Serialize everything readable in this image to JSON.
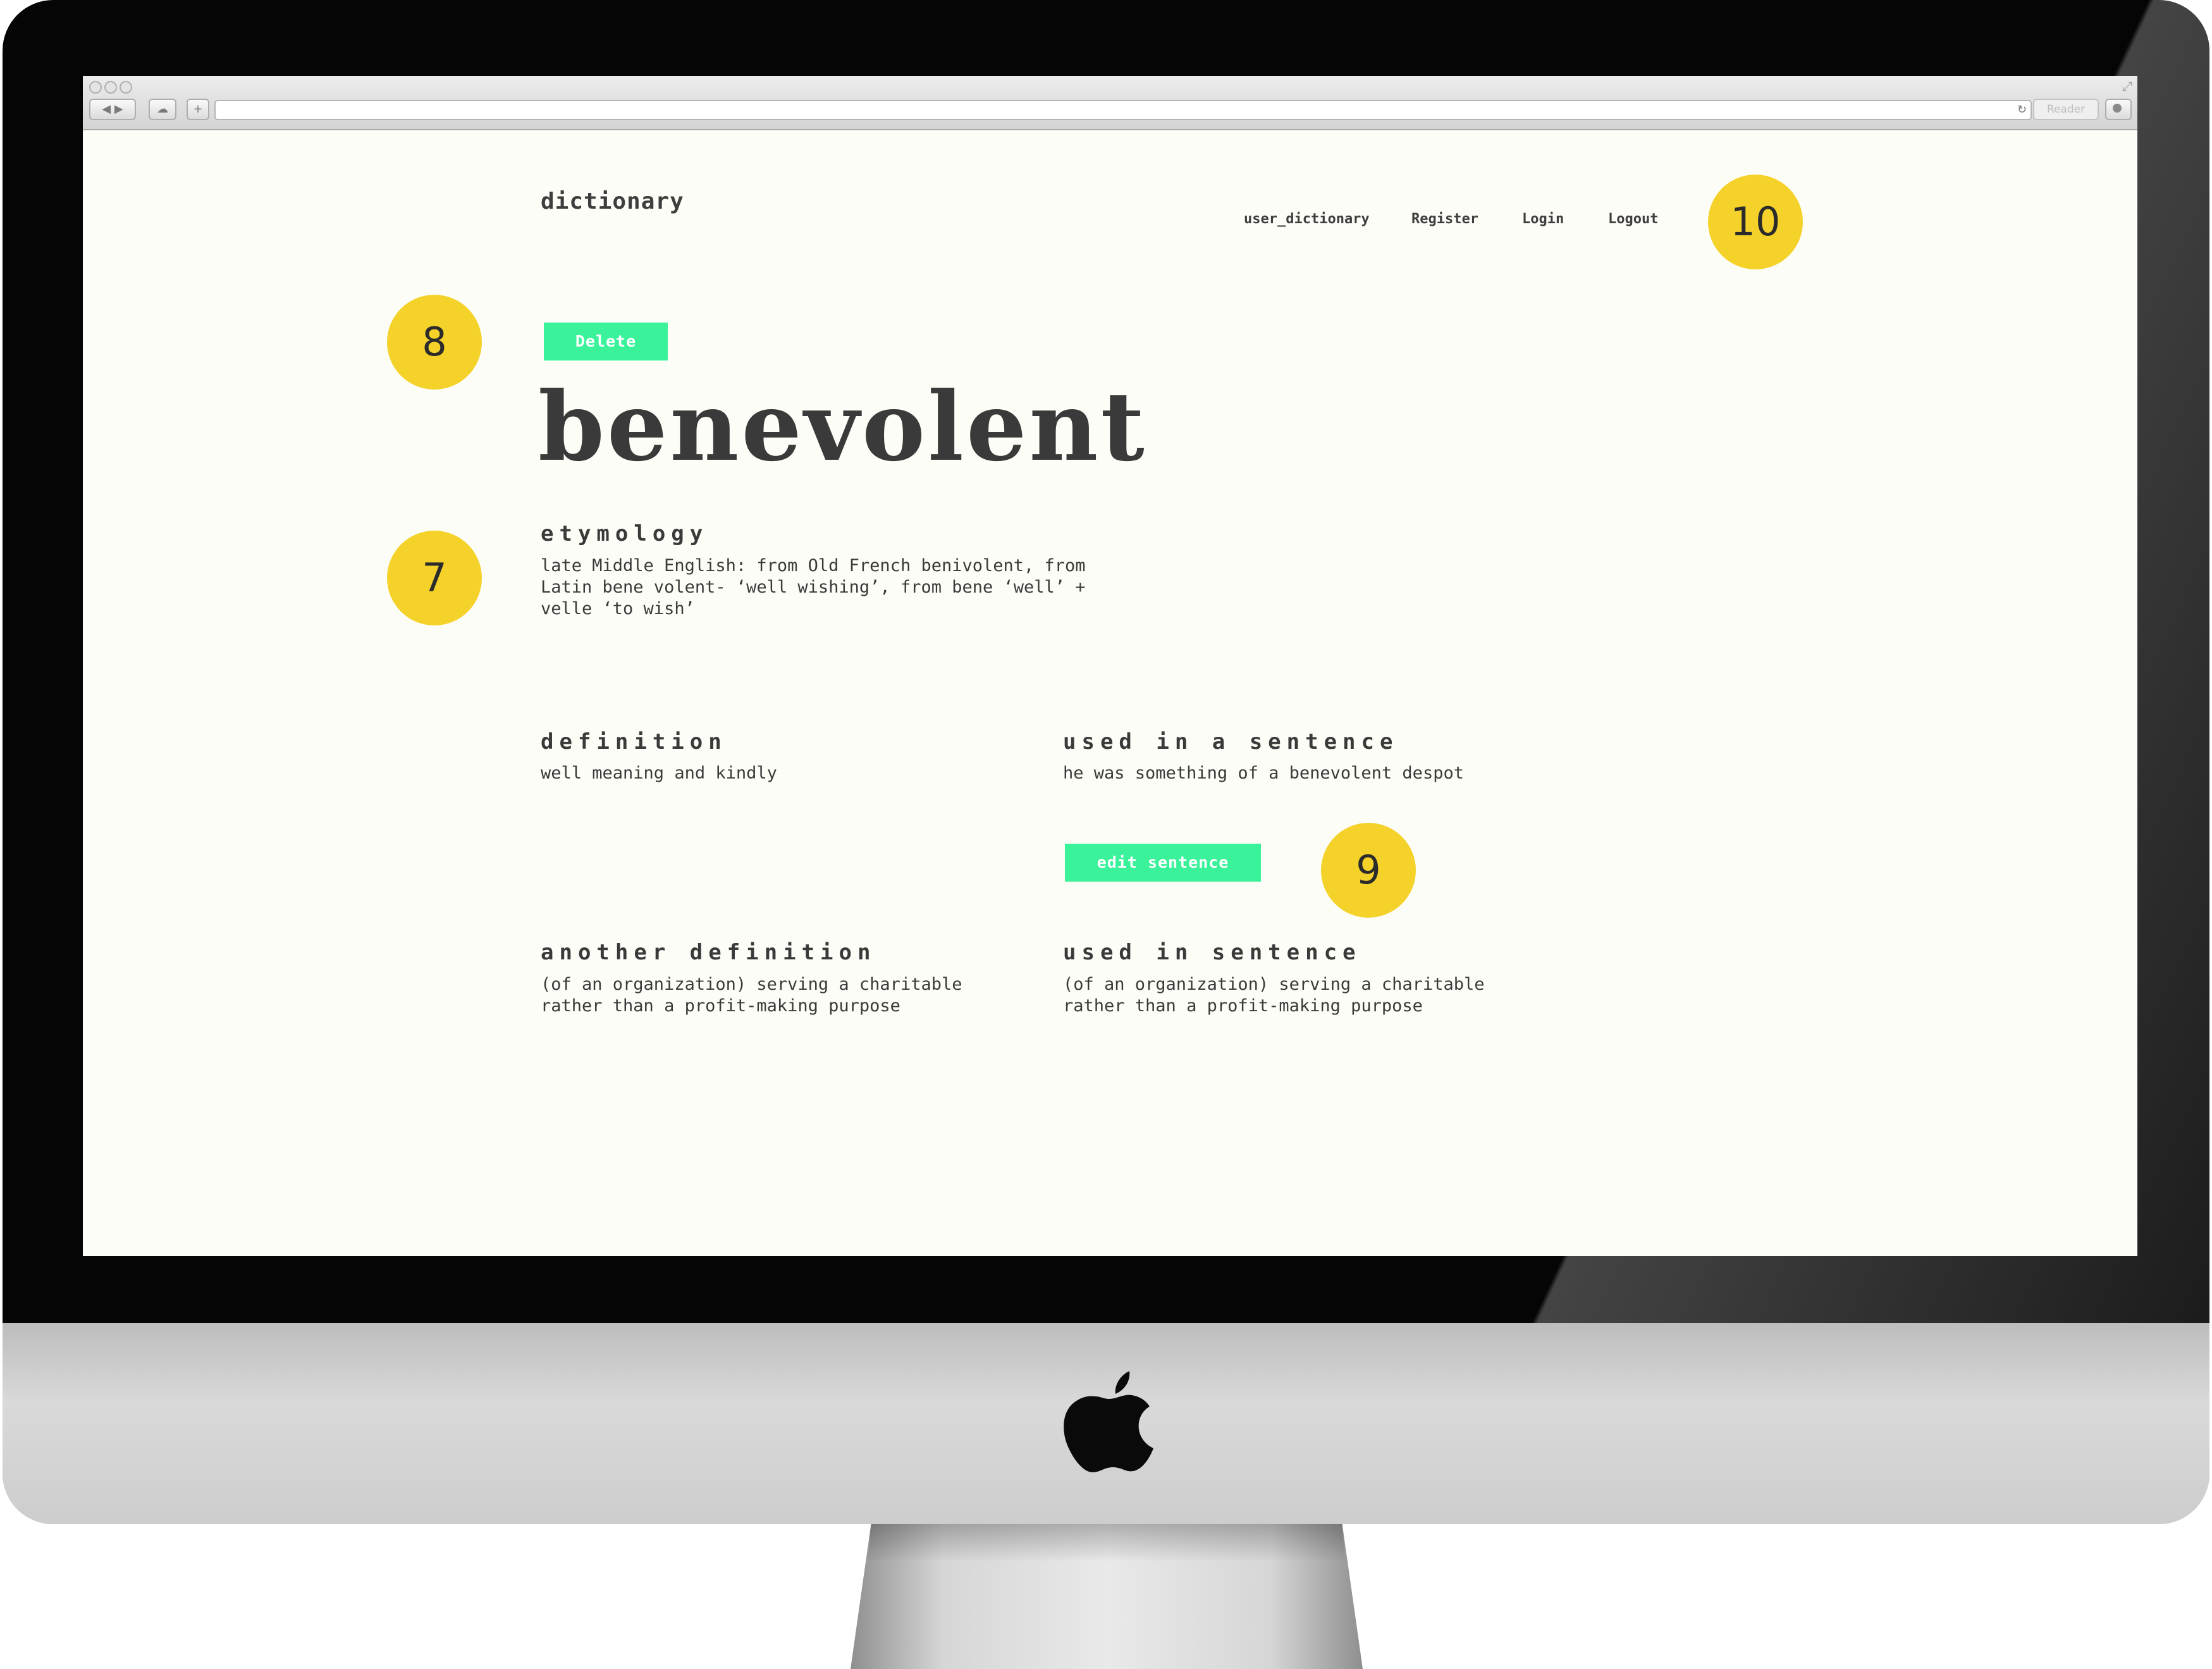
{
  "page": {
    "logo": "dictionary",
    "nav": [
      "user_dictionary",
      "Register",
      "Login",
      "Logout"
    ],
    "delete_label": "Delete",
    "word": "benevolent",
    "etymology": {
      "heading": "etymology",
      "text": "late Middle English: from Old French benivolent, from\nLatin bene volent- ‘well wishing’, from bene ‘well’ +\nvelle ‘to wish’"
    },
    "definition": {
      "heading": "definition",
      "text": "well meaning and kindly"
    },
    "sentence": {
      "heading": "used in a sentence",
      "text": "he was something of a benevolent despot"
    },
    "edit_sentence_label": "edit sentence",
    "another_definition": {
      "heading": "another definition",
      "text": "(of an organization) serving a charitable\nrather than a profit-making purpose"
    },
    "sentence2": {
      "heading": "used in sentence",
      "text": "(of an organization) serving a charitable\nrather than a profit-making purpose"
    }
  },
  "markers": [
    "10",
    "8",
    "7",
    "9"
  ],
  "browser": {
    "reader_label": "Reader"
  },
  "colors": {
    "accent_green": "#3af29a",
    "marker_yellow": "#f4d22a",
    "page_background": "#fdfdf7",
    "text": "#3a3a3a"
  }
}
